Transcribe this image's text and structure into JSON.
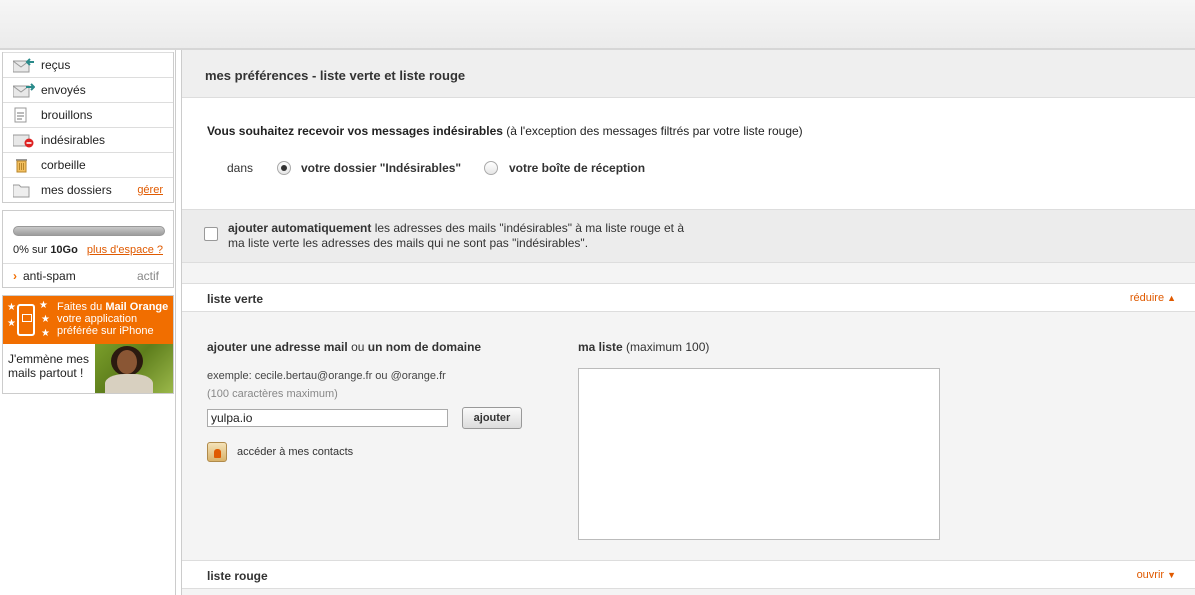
{
  "folders": [
    {
      "label": "reçus",
      "icon": "inbox-icon"
    },
    {
      "label": "envoyés",
      "icon": "sent-icon"
    },
    {
      "label": "brouillons",
      "icon": "draft-icon"
    },
    {
      "label": "indésirables",
      "icon": "spam-folder-icon"
    },
    {
      "label": "corbeille",
      "icon": "trash-icon"
    },
    {
      "label": "mes dossiers",
      "icon": "folder-icon",
      "action": "gérer"
    }
  ],
  "quota": {
    "used_fraction": 0.0,
    "percent_text": "0% sur",
    "total": "10Go",
    "more_link": "plus d'espace ?"
  },
  "antispam": {
    "label": "anti-spam",
    "status": "actif"
  },
  "promo": {
    "line1_prefix": "Faites du",
    "line1_bold": "Mail Orange",
    "line2": "votre application",
    "line3": "préférée sur iPhone",
    "caption_line1": "J'emmène mes",
    "caption_line2": "mails partout !"
  },
  "page_title": "mes préférences - liste verte et liste rouge",
  "preference": {
    "question_bold": "Vous souhaitez recevoir vos messages indésirables",
    "question_rest": " (à l'exception des messages filtrés par votre liste rouge)",
    "in_label": "dans",
    "option_folder": "votre dossier \"Indésirables\"",
    "option_inbox": "votre boîte de réception",
    "selected": "folder"
  },
  "auto_add": {
    "bold": "ajouter automatiquement",
    "rest1": " les adresses des mails \"indésirables\" à ma liste rouge et à",
    "line2": "ma liste verte les adresses des mails qui ne sont pas \"indésirables\".",
    "checked": false
  },
  "green_list": {
    "title": "liste verte",
    "toggle": "réduire",
    "add_bold1": "ajouter une adresse mail",
    "add_or": " ou ",
    "add_bold2": "un nom de domaine",
    "example": "exemple: cecile.bertau@orange.fr ou @orange.fr",
    "max_note": "(100 caractères maximum)",
    "input_value": "yulpa.io",
    "add_button": "ajouter",
    "contacts_link": "accéder à mes contacts",
    "list_title_bold": "ma liste",
    "list_title_rest": " (maximum 100)"
  },
  "red_list": {
    "title": "liste rouge",
    "toggle": "ouvrir"
  },
  "colors": {
    "accent": "#f16e00",
    "link": "#e05a00"
  }
}
